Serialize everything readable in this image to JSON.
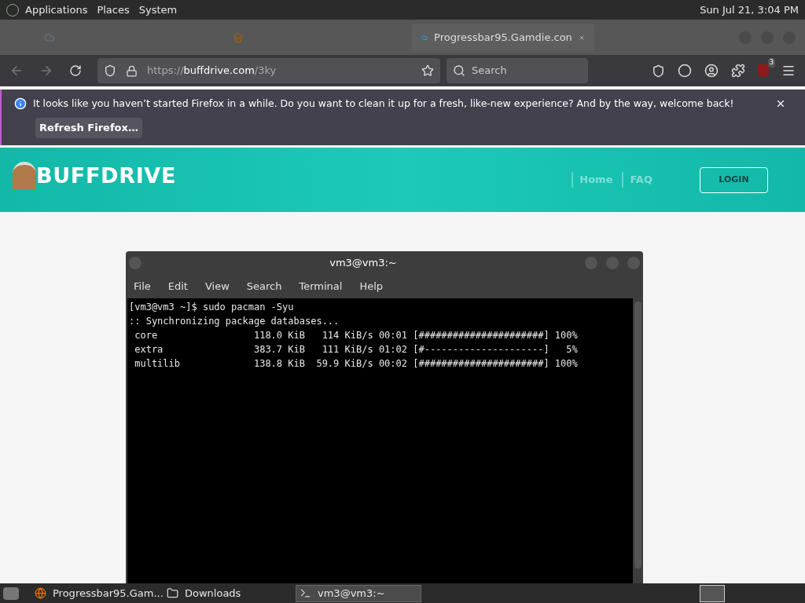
{
  "top_panel": {
    "menus": [
      "Applications",
      "Places",
      "System"
    ],
    "clock": "Sun Jul 21, 3:04 PM"
  },
  "browser": {
    "tabs": [
      {
        "selected": false
      },
      {
        "selected": false
      },
      {
        "title": "Progressbar95.Gamdie.con",
        "selected": true
      }
    ],
    "url": {
      "prefix": "https://",
      "domain": "buffdrive.com",
      "path": "/3ky"
    },
    "search": {
      "placeholder": "Search"
    },
    "extension_badge": "3",
    "notification": {
      "message": "It looks like you haven’t started Firefox in a while. Do you want to clean it up for a fresh, like-new experience? And by the way, welcome back!",
      "button": "Refresh Firefox…"
    }
  },
  "site": {
    "logo": "BUFFDRIVE",
    "nav": [
      "Home",
      "FAQ"
    ],
    "login": "LOGIN"
  },
  "terminal": {
    "title": "vm3@vm3:~",
    "menu": [
      "File",
      "Edit",
      "View",
      "Search",
      "Terminal",
      "Help"
    ],
    "lines": [
      "[vm3@vm3 ~]$ sudo pacman -Syu",
      ":: Synchronizing package databases...",
      " core                 118.0 KiB   114 KiB/s 00:01 [######################] 100%",
      " extra                383.7 KiB   111 KiB/s 01:02 [#---------------------]   5%",
      " multilib             138.8 KiB  59.9 KiB/s 00:02 [######################] 100%"
    ]
  },
  "taskbar": {
    "items": [
      {
        "label": "Progressbar95.Gam...",
        "kind": "browser",
        "selected": false
      },
      {
        "label": "Downloads",
        "kind": "folder",
        "selected": false
      },
      {
        "label": "vm3@vm3:~",
        "kind": "terminal",
        "selected": true
      }
    ]
  }
}
